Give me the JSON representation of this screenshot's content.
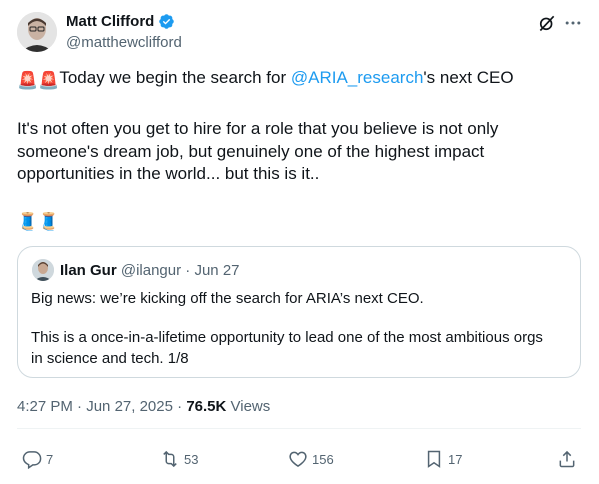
{
  "author": {
    "name": "Matt Clifford",
    "handle": "@matthewclifford"
  },
  "tweet": {
    "line1_prefix": "Today we begin the search for ",
    "line1_mention": "@ARIA_research",
    "line1_suffix": "'s next CEO",
    "line2": "It's not often you get to hire for a role that you believe is not only",
    "line3": "someone's dream job, but genuinely one of the highest impact",
    "line4": "opportunities in the world... but this is it..",
    "emoji_siren": "🚨",
    "emoji_thread": "🧵"
  },
  "quote": {
    "name": "Ilan Gur",
    "handle": "@ilangur",
    "separator": "·",
    "date": "Jun 27",
    "line1": "Big news: we’re kicking off the search for ARIA’s next CEO.",
    "line2": "This is a once-in-a-lifetime opportunity to lead one of the most ambitious orgs",
    "line3": "in science and tech. 1/8"
  },
  "meta": {
    "time": "4:27 PM",
    "separator": "·",
    "date": "Jun 27, 2025",
    "views_count": "76.5K",
    "views_label": "Views"
  },
  "actions": {
    "replies": "7",
    "reposts": "53",
    "likes": "156",
    "bookmarks": "17"
  },
  "colors": {
    "accent": "#1d9bf0",
    "text": "#0f1419",
    "muted": "#536471",
    "border": "#cfd9de"
  },
  "icons": [
    "verified-badge-icon",
    "grok-icon",
    "more-icon",
    "reply-icon",
    "repost-icon",
    "like-icon",
    "bookmark-icon",
    "share-icon"
  ]
}
